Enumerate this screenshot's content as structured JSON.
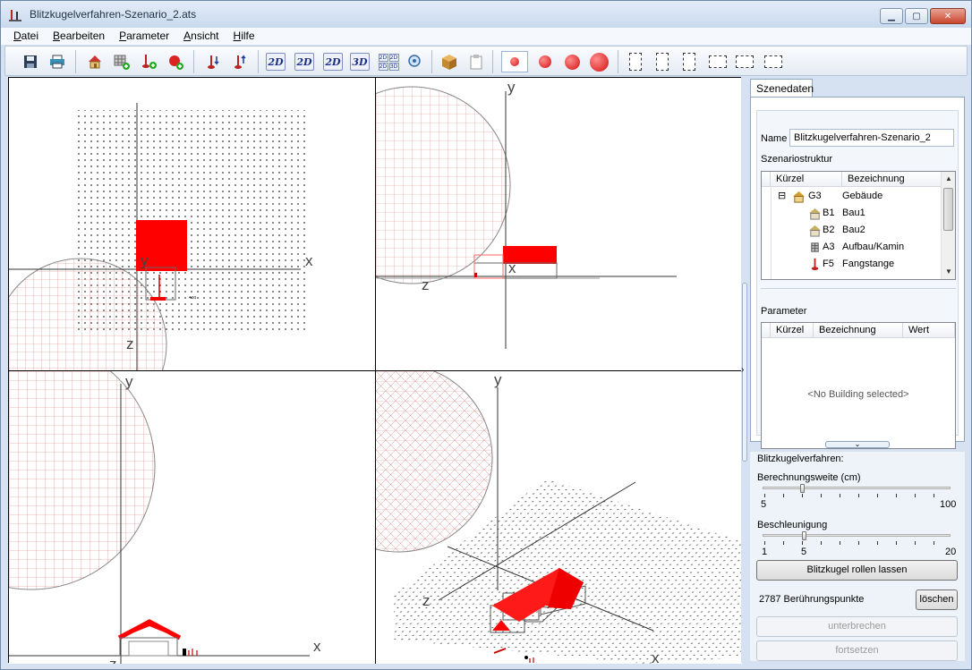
{
  "window": {
    "title": "Blitzkugelverfahren-Szenario_2.ats",
    "controls": {
      "minimize": "▁",
      "maximize": "▢",
      "close": "✕"
    }
  },
  "menu": [
    {
      "label": "Datei",
      "accel": "D",
      "rest": "atei"
    },
    {
      "label": "Bearbeiten",
      "accel": "B",
      "rest": "earbeiten"
    },
    {
      "label": "Parameter",
      "accel": "P",
      "rest": "arameter"
    },
    {
      "label": "Ansicht",
      "accel": "A",
      "rest": "nsicht"
    },
    {
      "label": "Hilfe",
      "accel": "H",
      "rest": "ilfe"
    }
  ],
  "toolbar": {
    "view_2d_a": "2D",
    "view_2d_b": "2D",
    "view_2d_c": "2D",
    "view_3d": "3D",
    "quad_tl": "2D",
    "quad_tr": "2D",
    "quad_bl": "2D",
    "quad_br": "3D"
  },
  "viewports": {
    "top": {
      "axis_x": "x",
      "axis_y": "y",
      "axis_z": "z"
    },
    "front": {
      "axis_x": "x",
      "axis_y": "y",
      "axis_z": "z"
    },
    "side": {
      "axis_x": "x",
      "axis_y": "y",
      "axis_z": "z"
    },
    "persp": {
      "axis_x": "x",
      "axis_y": "y",
      "axis_z": "z"
    }
  },
  "side_panel": {
    "tab": "Szenedaten",
    "name_label": "Name",
    "name_value": "Blitzkugelverfahren-Szenario_2",
    "structure_label": "Szenariostruktur",
    "tree_headers": {
      "code": "Kürzel",
      "desc": "Bezeichnung"
    },
    "tree": [
      {
        "code": "G3",
        "desc": "Gebäude",
        "icon": "house-icon",
        "expand": "⊟"
      },
      {
        "code": "B1",
        "desc": "Bau1",
        "icon": "building-icon"
      },
      {
        "code": "B2",
        "desc": "Bau2",
        "icon": "building-icon"
      },
      {
        "code": "A3",
        "desc": "Aufbau/Kamin",
        "icon": "chimney-icon"
      },
      {
        "code": "F5",
        "desc": "Fangstange",
        "icon": "rod-icon"
      }
    ],
    "parameter_label": "Parameter",
    "param_headers": {
      "code": "Kürzel",
      "desc": "Bezeichnung",
      "value": "Wert"
    },
    "param_empty": "<No Building selected>"
  },
  "blitz": {
    "title": "Blitzkugelverfahren:",
    "range_label": "Berechnungsweite (cm)",
    "range_min": "5",
    "range_max": "100",
    "range_value_fraction": 0.2,
    "accel_label": "Beschleunigung",
    "accel_min": "1",
    "accel_mid": "5",
    "accel_max": "20",
    "accel_value_fraction": 0.21,
    "roll_button": "Blitzkugel rollen lassen",
    "points_text": "2787 Berührungspunkte",
    "delete_button": "löschen",
    "interrupt_button": "unterbrechen",
    "continue_button": "fortsetzen"
  }
}
